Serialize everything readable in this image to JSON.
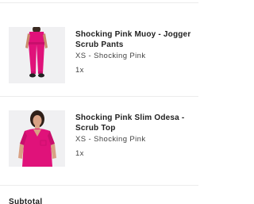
{
  "cart": {
    "items": [
      {
        "name": "Shocking Pink Muoy - Jogger Scrub Pants",
        "variant": "XS - Shocking Pink",
        "quantity": "1x",
        "image": "jogger-scrub-pants-photo"
      },
      {
        "name": "Shocking Pink Slim Odesa - Scrub Top",
        "variant": "XS - Shocking Pink",
        "quantity": "1x",
        "image": "scrub-top-photo"
      }
    ],
    "subtotal_label": "Subtotal"
  },
  "colors": {
    "product_pink": "#e0127a",
    "thumbnail_bg": "#f0f0f2",
    "divider": "#ececec"
  }
}
